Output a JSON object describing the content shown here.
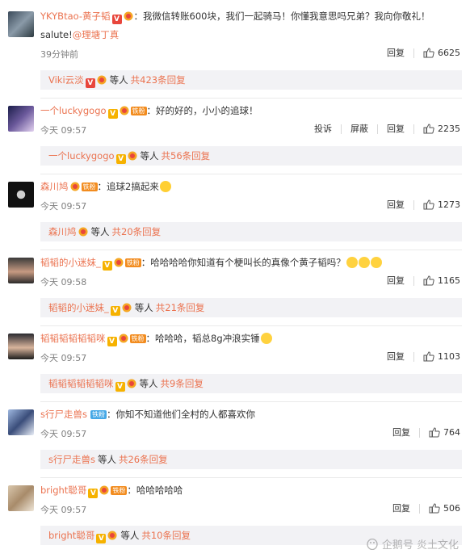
{
  "comments": [
    {
      "username": "YKYBtao-黄子韬",
      "badge": "V",
      "badge_color": "red",
      "text": "：我微信转账600块，我们一起骑马！你懂我意思吗兄弟？我向你敬礼！",
      "text2": "salute!",
      "mention": "@理塘丁真",
      "time": "39分钟前",
      "reply_label": "回复",
      "likes": "6625",
      "sub_user": "Viki云淡",
      "sub_deng": "等人",
      "sub_count": "共423条回复"
    },
    {
      "username": "一个luckygogo",
      "badge": "V",
      "fan_label": "铁粉",
      "text": "：好的好的，小小的追球！",
      "time": "今天 09:57",
      "report_label": "投诉",
      "block_label": "屏蔽",
      "reply_label": "回复",
      "likes": "2235",
      "sub_user": "一个luckygogo",
      "sub_deng": "等人",
      "sub_count": "共56条回复"
    },
    {
      "username": "森川鸠",
      "fan_label": "铁粉",
      "text": "：追球2搞起来",
      "time": "今天 09:57",
      "reply_label": "回复",
      "likes": "1273",
      "sub_user": "森川鸠",
      "sub_deng": "等人",
      "sub_count": "共20条回复"
    },
    {
      "username": "韬韬的小迷妹_",
      "badge": "V",
      "fan_label": "铁粉",
      "text": "：哈哈哈哈你知道有个梗叫长的真像个黄子韬吗？",
      "time": "今天 09:58",
      "reply_label": "回复",
      "likes": "1165",
      "sub_user": "韬韬的小迷妹_",
      "sub_deng": "等人",
      "sub_count": "共21条回复"
    },
    {
      "username": "韬韬韬韬韬韬咪",
      "badge": "V",
      "fan_label": "铁粉",
      "text": "：哈哈哈，韬总8g冲浪实锤",
      "time": "今天 09:57",
      "reply_label": "回复",
      "likes": "1103",
      "sub_user": "韬韬韬韬韬韬咪",
      "sub_deng": "等人",
      "sub_count": "共9条回复"
    },
    {
      "username": "s行尸走兽s",
      "fan_label": "铁粉",
      "text": "：你知不知道他们全村的人都喜欢你",
      "time": "今天 09:57",
      "reply_label": "回复",
      "likes": "764",
      "sub_user": "s行尸走兽s",
      "sub_deng": "等人",
      "sub_count": "共26条回复"
    },
    {
      "username": "bright聪哥",
      "badge": "V",
      "fan_label": "铁粉",
      "text": "：哈哈哈哈哈",
      "time": "今天 09:57",
      "reply_label": "回复",
      "likes": "506",
      "sub_user": "bright聪哥",
      "sub_deng": "等人",
      "sub_count": "共10条回复"
    }
  ],
  "watermark": "企鹅号 炎土文化",
  "colors": {
    "accent": "#eb7350",
    "subbox_bg": "#f2f2f5",
    "muted": "#808080"
  }
}
